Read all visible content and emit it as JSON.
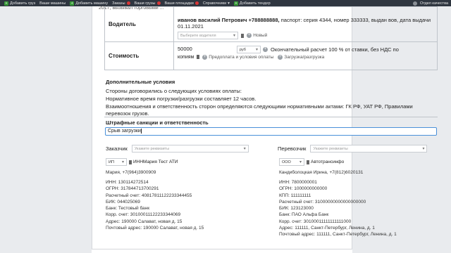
{
  "topbar": {
    "items": [
      {
        "label": "Добавить груз",
        "plus": true
      },
      {
        "label": "Ваши машины",
        "plus": false
      },
      {
        "label": "Добавить машину",
        "plus": true
      },
      {
        "label": "Заказы",
        "badge": true
      },
      {
        "label": "Ваши грузы",
        "badge": true
      },
      {
        "label": "Ваши площадки",
        "badge": true
      },
      {
        "label": "Справочники",
        "badge": false
      },
      {
        "label": "Добавить тендер",
        "plus": true
      }
    ],
    "right_label": "Отдел качества"
  },
  "cut_text": "2017, вызывал торговыми ...",
  "driver": {
    "label": "Водитель",
    "value": "иванов василий Петрович +788888888,",
    "details": " паспорт: серия 4344, номер 333333, выдан вов, дата выдачи 01.11.2021",
    "select_placeholder": "Выберите водителя",
    "new_label": "Новый"
  },
  "cost": {
    "label": "Стоимость",
    "amount": "50000",
    "currency": "руб",
    "terms_line1": "Окончательный расчет 100 % от ставки,  без НДС по",
    "terms_line2": "копиям",
    "prepay_label": "Предоплата и условия оплаты",
    "loading_label": "Загрузка/разгрузка"
  },
  "conditions": {
    "heading": "Дополнительные условия",
    "line1": "Стороны договорились о следующих условиях оплаты:",
    "line2": "Нормативное время погрузки/разгрузки составляет 12 часов.",
    "line3": "Взаимоотношения и ответственность сторон определяются следующими нормативными актами: ГК РФ, УАТ РФ, Правилами",
    "line4": "перевозок грузов."
  },
  "penalties": {
    "heading": "Штрафные санкции и ответственность",
    "value": "Срыв загрузки"
  },
  "customer": {
    "label": "Заказчик",
    "placeholder": "Укажите реквизиты",
    "form": "ИП",
    "name": "ИННМария Тест АТИ",
    "contact": "Мария, +7(964)3900909",
    "lines": [
      "ИНН: 130114272514",
      "ОГРН: 317844713700291",
      "Расчетный счет: 40817811122233344455",
      "БИК: 044025069",
      "Банк: Тестовый банк",
      "Корр. счет: 30100011122233344069",
      "Адрес: 190000 Салават, новая д. 15",
      "Почтовый адрес: 190000 Салават, новая д. 15"
    ]
  },
  "carrier": {
    "label": "Перевозчик",
    "placeholder": "Укажите реквизиты",
    "form": "ООО",
    "name": "Автотрансинфо",
    "contact": "Кандиболоцкая Ирина, +7(812)6020131",
    "lines": [
      "ИНН: 7800000001",
      "ОГРН: 1000000000000",
      "КПП: 111111111",
      "Расчетный счет: 31000000000000000000",
      "БИК: 123123000",
      "Банк: ПАО Альфа Банк",
      "Корр. счет: 30100011111111111000",
      "Адрес: 111111, Санкт-Петербург, Ленина, д. 1",
      "Почтовый адрес: 111111, Санкт-Петербург, Ленина, д. 1"
    ]
  }
}
